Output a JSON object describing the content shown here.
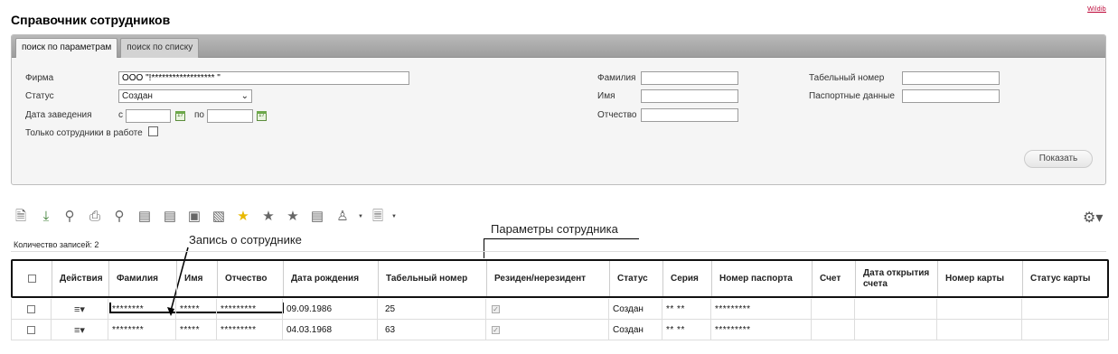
{
  "page": {
    "title": "Справочник сотрудников",
    "brand": "Wildib"
  },
  "tabs": [
    "поиск по параметрам",
    "поиск по списку"
  ],
  "filters": {
    "firm_label": "Фирма",
    "firm_value": "ООО \"!****************** \"",
    "status_label": "Статус",
    "status_value": "Создан",
    "date_label": "Дата заведения",
    "date_from_label": "с",
    "date_to_label": "по",
    "calendar_glyph": "17",
    "active_only_label": "Только сотрудники в работе",
    "lastname_label": "Фамилия",
    "firstname_label": "Имя",
    "middlename_label": "Отчество",
    "tabnum_label": "Табельный номер",
    "passport_label": "Паспортные данные",
    "show_button": "Показать"
  },
  "toolbar": {
    "icons": [
      "new-document-icon",
      "download-icon",
      "badge-icon",
      "print-icon",
      "award-icon",
      "card-icon",
      "cards-icon",
      "card-remove-icon",
      "card-stack-icon",
      "star-icon",
      "star-gear-icon",
      "star-outline-icon",
      "card-list-icon",
      "users-icon",
      "document-icon"
    ],
    "settings_icon": "gear-icon"
  },
  "annotations": {
    "record": "Запись о сотруднике",
    "params": "Параметры сотрудника"
  },
  "records_count": "Количество записей: 2",
  "table": {
    "columns": [
      "",
      "Действия",
      "Фамилия",
      "Имя",
      "Отчество",
      "Дата рождения",
      "Табельный номер",
      "Резиден/нерезидент",
      "Статус",
      "Серия",
      "Номер паспорта",
      "Счет",
      "Дата открытия счета",
      "Номер карты",
      "Статус карты"
    ],
    "rows": [
      {
        "lastname": "********",
        "firstname": "*****",
        "middlename": "*********",
        "birth": "09.09.1986",
        "tabnum": "25",
        "resident": true,
        "status": "Создан",
        "series": "** **",
        "passport": "*********",
        "account": "",
        "opened": "",
        "card": "",
        "card_status": ""
      },
      {
        "lastname": "********",
        "firstname": "*****",
        "middlename": "*********",
        "birth": "04.03.1968",
        "tabnum": "63",
        "resident": true,
        "status": "Создан",
        "series": "** **",
        "passport": "*********",
        "account": "",
        "opened": "",
        "card": "",
        "card_status": ""
      }
    ]
  }
}
